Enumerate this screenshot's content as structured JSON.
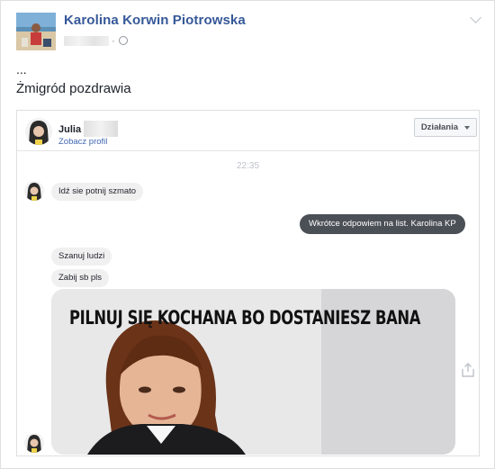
{
  "post": {
    "author": "Karolina Korwin Piotrowska",
    "separator": "·",
    "text_line1": "...",
    "text_line2": "Żmigród pozdrawia"
  },
  "messenger": {
    "contact_name": "Julia",
    "profile_link": "Zobacz profil",
    "actions_label": "Działania",
    "timestamp": "22:35",
    "messages": [
      {
        "from": "contact",
        "text": "Idź sie potnij szmato"
      },
      {
        "from": "auto_reply",
        "text": "Wkrótce odpowiem na list. Karolina KP"
      },
      {
        "from": "contact",
        "text": "Szanuj ludzi"
      },
      {
        "from": "contact",
        "text": "Zabij sb pls"
      }
    ],
    "meme_caption": "PILNUJ SIĘ KOCHANA BO DOSTANIESZ BANA"
  },
  "icons": {
    "globe": "globe-icon",
    "chevron": "chevron-down-icon",
    "share": "share-icon",
    "caret": "caret-down-icon"
  },
  "colors": {
    "link": "#365899",
    "outgoing_bubble": "#4b4f56",
    "incoming_bubble": "#f1f0f0"
  }
}
